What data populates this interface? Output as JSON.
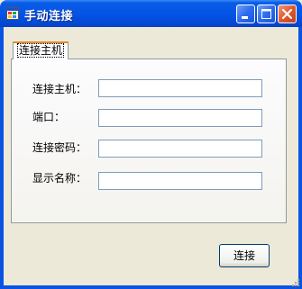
{
  "window": {
    "title": "手动连接",
    "icon": "app-window-icon",
    "controls": [
      "minimize-icon",
      "maximize-icon",
      "close-icon"
    ]
  },
  "tab": {
    "label": "连接主机"
  },
  "form": {
    "host_label": "连接主机：",
    "port_label": "端口：",
    "password_label": "连接密码：",
    "display_name_label": "显示名称：",
    "host_value": "",
    "port_value": "",
    "password_value": "",
    "display_name_value": ""
  },
  "actions": {
    "connect_label": "连接"
  },
  "colors": {
    "titlebar": "#0554e6",
    "tab_accent": "#e68b2c",
    "client": "#ece9d8",
    "close": "#e2582c"
  }
}
